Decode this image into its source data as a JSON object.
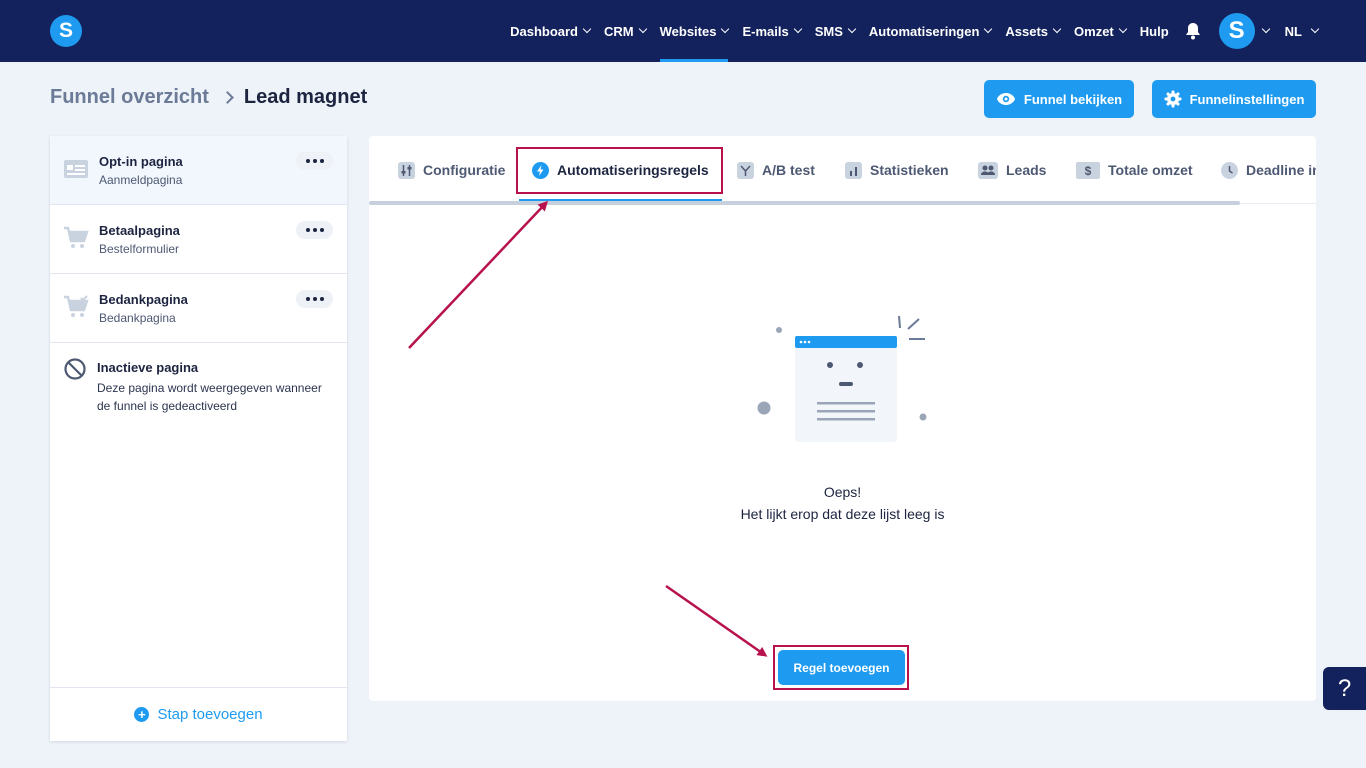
{
  "app": {
    "logo_letter": "S"
  },
  "nav": {
    "items": [
      {
        "label": "Dashboard",
        "dropdown": true,
        "active": false
      },
      {
        "label": "CRM",
        "dropdown": true,
        "active": false
      },
      {
        "label": "Websites",
        "dropdown": true,
        "active": true
      },
      {
        "label": "E-mails",
        "dropdown": true,
        "active": false
      },
      {
        "label": "SMS",
        "dropdown": true,
        "active": false
      },
      {
        "label": "Automatiseringen",
        "dropdown": true,
        "active": false
      },
      {
        "label": "Assets",
        "dropdown": true,
        "active": false
      },
      {
        "label": "Omzet",
        "dropdown": true,
        "active": false
      },
      {
        "label": "Hulp",
        "dropdown": false,
        "active": false
      }
    ],
    "bell_icon": "bell-icon",
    "avatar_letter": "S",
    "language": "NL"
  },
  "breadcrumb": {
    "parent": "Funnel overzicht",
    "current": "Lead magnet"
  },
  "header_buttons": {
    "view_label": "Funnel bekijken",
    "settings_label": "Funnelinstellingen"
  },
  "steps": [
    {
      "title": "Opt-in pagina",
      "subtitle": "Aanmeldpagina",
      "icon": "optin-page-icon",
      "selected": true
    },
    {
      "title": "Betaalpagina",
      "subtitle": "Bestelformulier",
      "icon": "cart-icon",
      "selected": false
    },
    {
      "title": "Bedankpagina",
      "subtitle": "Bedankpagina",
      "icon": "cart-check-icon",
      "selected": false
    }
  ],
  "inactive": {
    "title": "Inactieve pagina",
    "description": "Deze pagina wordt weergegeven wanneer de funnel is gedeactiveerd"
  },
  "add_step_label": "Stap toevoegen",
  "tabs": [
    {
      "label": "Configuratie",
      "icon": "sliders-icon",
      "active": false
    },
    {
      "label": "Automatiseringsregels",
      "icon": "lightning-icon",
      "active": true
    },
    {
      "label": "A/B test",
      "icon": "split-icon",
      "active": false
    },
    {
      "label": "Statistieken",
      "icon": "bar-chart-icon",
      "active": false
    },
    {
      "label": "Leads",
      "icon": "users-icon",
      "active": false
    },
    {
      "label": "Totale omzet",
      "icon": "dollar-icon",
      "active": false
    },
    {
      "label": "Deadline in",
      "icon": "clock-icon",
      "active": false
    }
  ],
  "empty_state": {
    "line1": "Oeps!",
    "line2": "Het lijkt erop dat deze lijst leeg is"
  },
  "add_rule_label": "Regel toevoegen",
  "help_label": "?",
  "colors": {
    "nav_bg": "#13225c",
    "accent": "#1e9bf0",
    "highlight": "#b8124e",
    "page_bg": "#eef3f9"
  }
}
